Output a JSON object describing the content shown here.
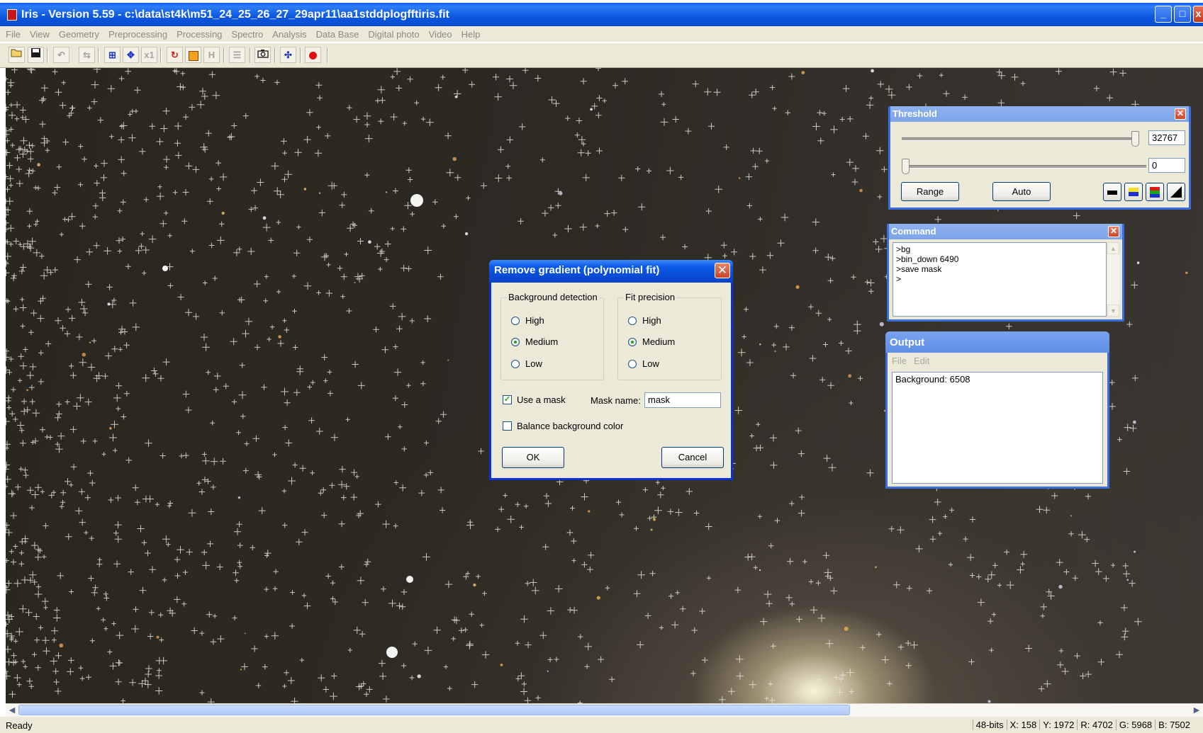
{
  "window": {
    "title": "Iris - Version 5.59 - c:\\data\\st4k\\m51_24_25_26_27_29apr11\\aa1stddplogfftiris.fit",
    "buttons": {
      "minimize": "_",
      "maximize": "□",
      "close": "x"
    }
  },
  "menu": [
    "File",
    "View",
    "Geometry",
    "Preprocessing",
    "Processing",
    "Spectro",
    "Analysis",
    "Data Base",
    "Digital photo",
    "Video",
    "Help"
  ],
  "toolbar": {
    "tool_x1_label": "x1",
    "tool_h_label": "H"
  },
  "threshold": {
    "title": "Threshold",
    "high_value": "32767",
    "low_value": "0",
    "high_level": 1.0,
    "low_level": 0.0,
    "range_label": "Range",
    "auto_label": "Auto"
  },
  "command": {
    "title": "Command",
    "lines": [
      ">bg",
      ">bin_down 6490",
      ">save mask",
      ">"
    ]
  },
  "output": {
    "title": "Output",
    "menu": [
      "File",
      "Edit"
    ],
    "text": "Background: 6508"
  },
  "dialog": {
    "title": "Remove gradient (polynomial fit)",
    "background_detection": {
      "label": "Background detection",
      "options": [
        "High",
        "Medium",
        "Low"
      ],
      "selected": "Medium"
    },
    "fit_precision": {
      "label": "Fit precision",
      "options": [
        "High",
        "Medium",
        "Low"
      ],
      "selected": "Medium"
    },
    "use_mask_label": "Use a mask",
    "use_mask_checked": true,
    "mask_name_label": "Mask name:",
    "mask_name_value": "mask",
    "balance_label": "Balance background color",
    "balance_checked": false,
    "ok_label": "OK",
    "cancel_label": "Cancel"
  },
  "status": {
    "ready": "Ready",
    "bits": "48-bits",
    "x": "X: 158",
    "y": "Y: 1972",
    "r": "R: 4702",
    "g": "G: 5968",
    "b": "B: 7502"
  }
}
